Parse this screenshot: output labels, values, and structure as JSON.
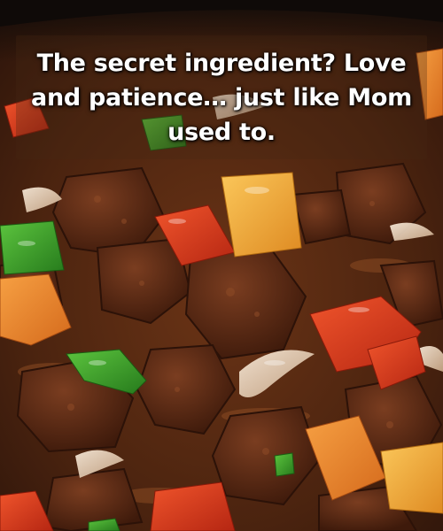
{
  "photo": {
    "subject": "beef stew with bell peppers and onions",
    "palette": {
      "stew_base": "#4a230f",
      "gravy": "#6b3416",
      "beef": "#5c2c17",
      "red_pepper": "#d8391c",
      "orange_pepper": "#e8842b",
      "yellow_pepper": "#f0a93a",
      "green_pepper": "#3d9c2c",
      "onion": "#e9d4bd",
      "pot_rim": "#1c1410"
    }
  },
  "caption": {
    "text": "The secret ingredient? Love and patience… just like Mom used to."
  }
}
